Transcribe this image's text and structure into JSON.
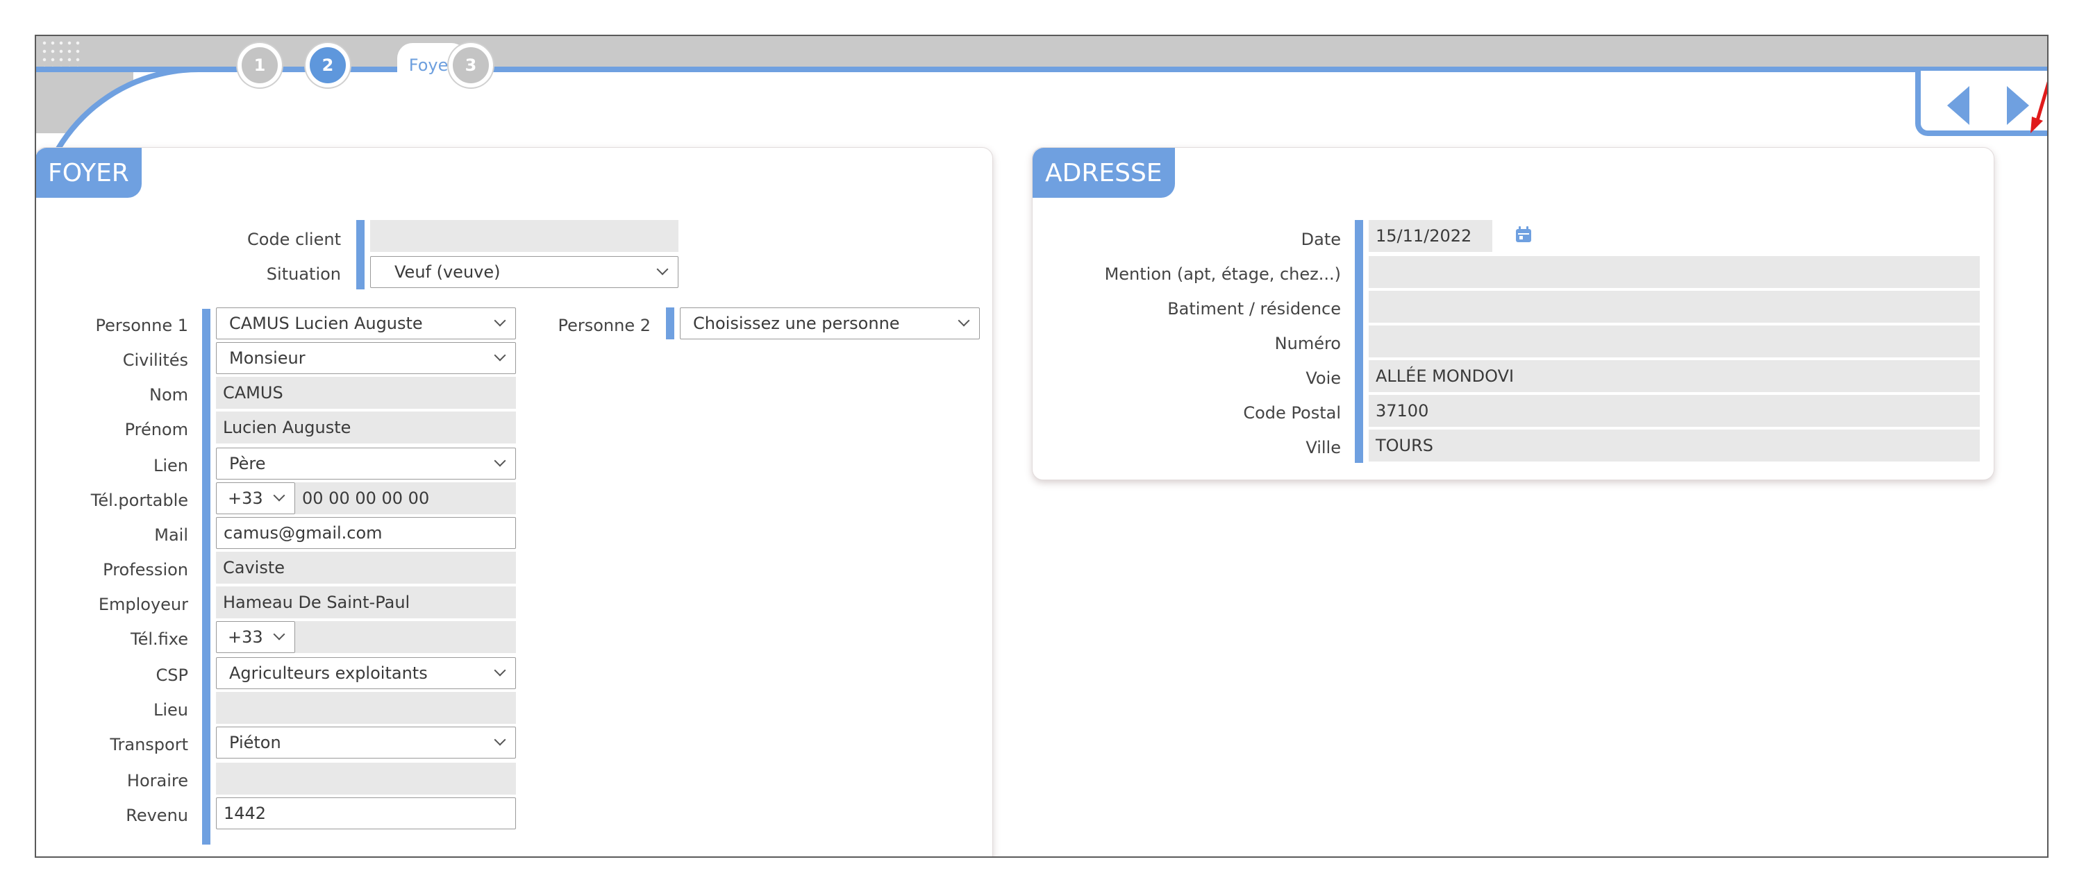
{
  "wizard": {
    "steps": [
      {
        "label": "1",
        "state": "done"
      },
      {
        "label": "2",
        "state": "active"
      },
      {
        "label": "3",
        "state": "todo"
      }
    ],
    "current_label": "Foyer"
  },
  "foyer": {
    "title": "FOYER",
    "code_client_label": "Code client",
    "code_client_value": "",
    "situation_label": "Situation",
    "situation_value": "Veuf (veuve)",
    "personne1_label": "Personne 1",
    "personne1_value": "CAMUS Lucien Auguste",
    "personne2_label": "Personne 2",
    "personne2_value": "Choisissez une personne",
    "civilites_label": "Civilités",
    "civilites_value": "Monsieur",
    "nom_label": "Nom",
    "nom_value": "CAMUS",
    "prenom_label": "Prénom",
    "prenom_value": "Lucien Auguste",
    "lien_label": "Lien",
    "lien_value": "Père",
    "tel_portable_label": "Tél.portable",
    "tel_portable_prefix": "+33",
    "tel_portable_value": "00 00 00 00 00",
    "mail_label": "Mail",
    "mail_value": "camus@gmail.com",
    "profession_label": "Profession",
    "profession_value": "Caviste",
    "employeur_label": "Employeur",
    "employeur_value": "Hameau De Saint-Paul",
    "tel_fixe_label": "Tél.fixe",
    "tel_fixe_prefix": "+33",
    "tel_fixe_value": "",
    "csp_label": "CSP",
    "csp_value": "Agriculteurs exploitants",
    "lieu_label": "Lieu",
    "lieu_value": "",
    "transport_label": "Transport",
    "transport_value": "Piéton",
    "horaire_label": "Horaire",
    "horaire_value": "",
    "revenu_label": "Revenu",
    "revenu_value": "1442"
  },
  "adresse": {
    "title": "ADRESSE",
    "date_label": "Date",
    "date_value": "15/11/2022",
    "mention_label": "Mention (apt, étage, chez...)",
    "mention_value": "",
    "batiment_label": "Batiment / résidence",
    "batiment_value": "",
    "numero_label": "Numéro",
    "numero_value": "",
    "voie_label": "Voie",
    "voie_value": "ALLÉE MONDOVI",
    "code_postal_label": "Code Postal",
    "code_postal_value": "37100",
    "ville_label": "Ville",
    "ville_value": "TOURS"
  },
  "nav": {
    "prev_icon": "triangle-left-icon",
    "next_icon": "triangle-right-icon"
  },
  "colors": {
    "accent": "#6fa0e0",
    "bar_grey": "#c9c9c9",
    "field_grey": "#e8e8e8",
    "pointer": "#e01b1b"
  }
}
